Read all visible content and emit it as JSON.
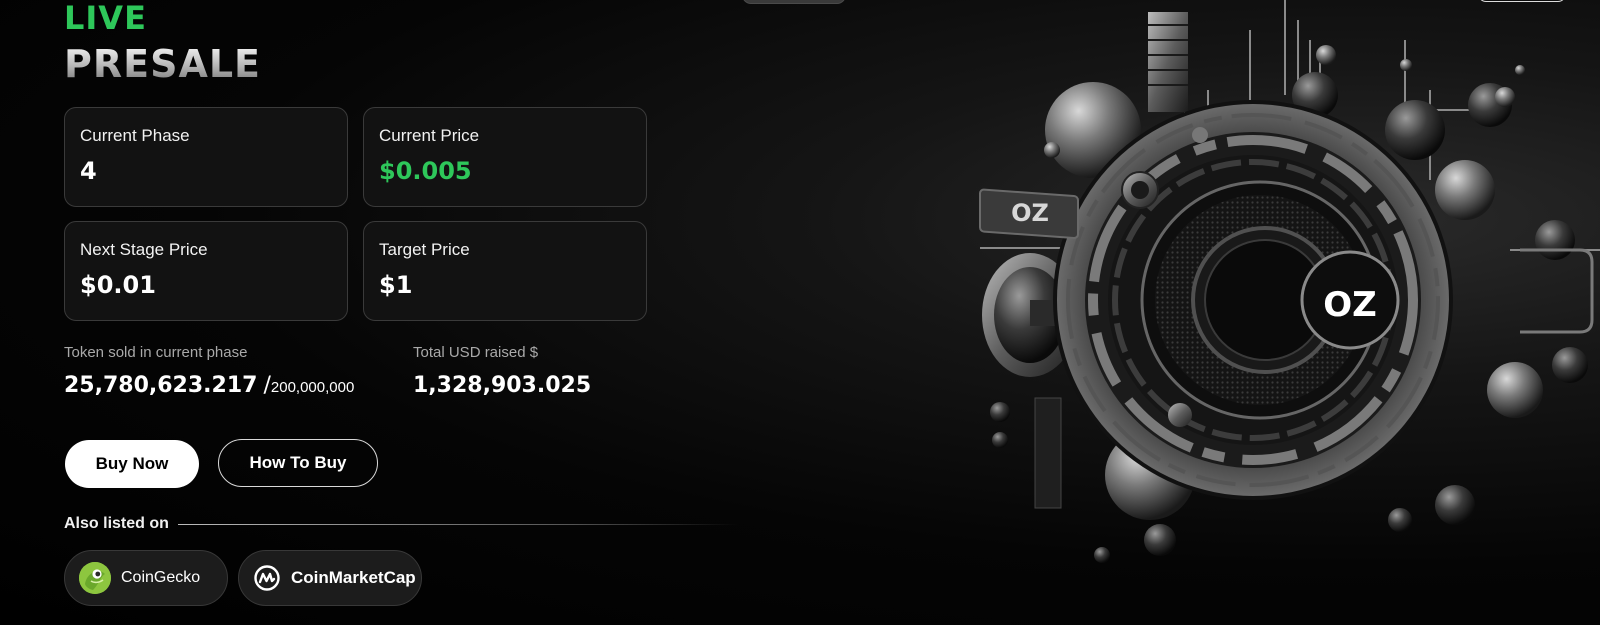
{
  "hero": {
    "live": "LIVE",
    "presale": "PRESALE"
  },
  "cards": [
    {
      "label": "Current Phase",
      "value": "4"
    },
    {
      "label": "Current Price",
      "value": "$0.005"
    },
    {
      "label": "Next Stage Price",
      "value": "$0.01"
    },
    {
      "label": "Target Price",
      "value": "$1"
    }
  ],
  "tokens": {
    "sold_label": "Token sold in current phase",
    "sold_value": "25,780,623.217",
    "separator": "/",
    "sold_total": "200,000,000",
    "raised_label": "Total USD raised $",
    "raised_value": "1,328,903.025"
  },
  "actions": {
    "buy_label": "Buy Now",
    "how_label": "How To Buy"
  },
  "listings": {
    "heading": "Also listed on",
    "items": [
      {
        "name": "CoinGecko",
        "icon": "coingecko-icon"
      },
      {
        "name": "CoinMarketCap",
        "icon": "coinmarketcap-icon"
      }
    ]
  },
  "artwork": {
    "badge_text": "OZ",
    "core_text": "OZ"
  },
  "colors": {
    "accent_green": "#2ec75a",
    "background": "#000000"
  }
}
